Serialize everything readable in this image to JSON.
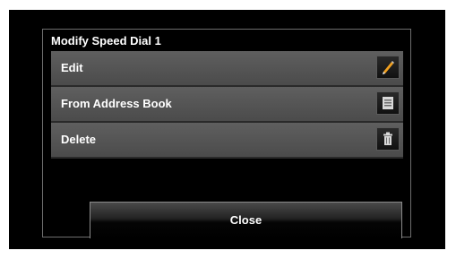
{
  "dialog": {
    "title": "Modify Speed Dial 1",
    "items": [
      {
        "label": "Edit",
        "icon": "pencil-icon"
      },
      {
        "label": "From Address Book",
        "icon": "address-book-icon"
      },
      {
        "label": "Delete",
        "icon": "trash-icon"
      }
    ],
    "close_label": "Close"
  },
  "colors": {
    "screen_background": "#000000",
    "menu_item": "#565656",
    "accent_pencil": "#f0a020"
  }
}
